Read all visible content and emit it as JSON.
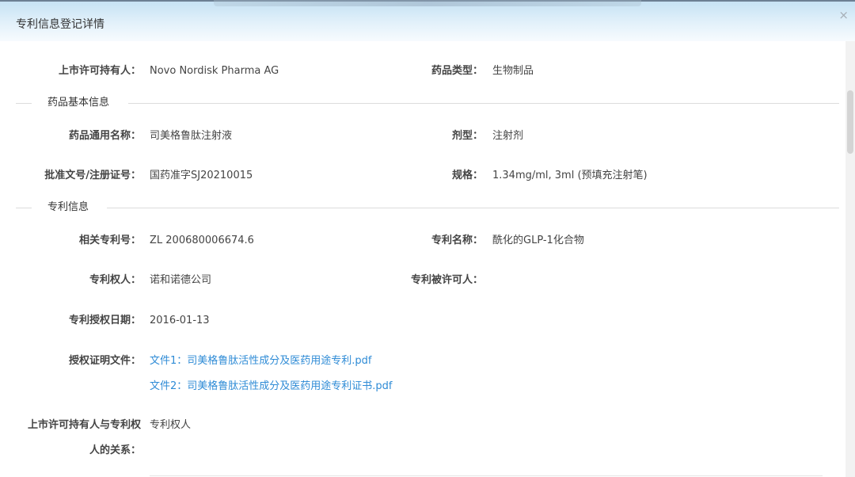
{
  "dialog": {
    "title": "专利信息登记详情",
    "close_glyph": "×"
  },
  "fields": {
    "holder_label": "上市许可持有人：",
    "holder_value": "Novo Nordisk Pharma AG",
    "drug_type_label": "药品类型：",
    "drug_type_value": "生物制品"
  },
  "section_basic": {
    "label": "药品基本信息",
    "generic_name_label": "药品通用名称：",
    "generic_name_value": "司美格鲁肽注射液",
    "dosage_form_label": "剂型：",
    "dosage_form_value": "注射剂",
    "approval_no_label": "批准文号/注册证号：",
    "approval_no_value": "国药准字SJ20210015",
    "spec_label": "规格：",
    "spec_value": "1.34mg/ml, 3ml (预填充注射笔)"
  },
  "section_patent": {
    "label": "专利信息",
    "patent_no_label": "相关专利号：",
    "patent_no_value": "ZL 200680006674.6",
    "patent_name_label": "专利名称：",
    "patent_name_value": "酰化的GLP-1化合物",
    "patentee_label": "专利权人：",
    "patentee_value": "诺和诺德公司",
    "licensee_label": "专利被许可人：",
    "licensee_value": "",
    "grant_date_label": "专利授权日期：",
    "grant_date_value": "2016-01-13",
    "cert_label": "授权证明文件：",
    "cert_files": [
      "文件1：司美格鲁肽活性成分及医药用途专利.pdf",
      "文件2：司美格鲁肽活性成分及医药用途专利证书.pdf"
    ],
    "relation_label_line1": "上市许可持有人与专利权",
    "relation_label_line2": "人的关系：",
    "relation_value": "专利权人"
  },
  "icons": {
    "close": "close-icon"
  }
}
